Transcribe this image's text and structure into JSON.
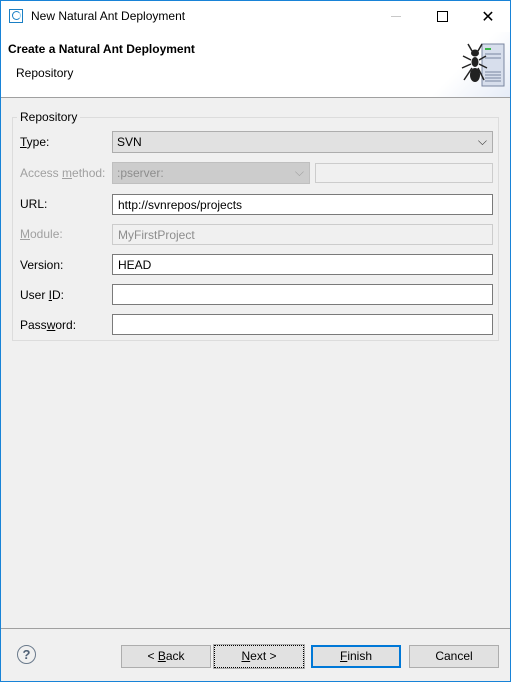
{
  "window": {
    "title": "New Natural Ant Deployment",
    "controls": [
      "minimize",
      "maximize",
      "close"
    ]
  },
  "header": {
    "title": "Create a Natural Ant Deployment",
    "subtitle": "Repository",
    "graphic": "ant-server-icon"
  },
  "repository": {
    "group_label": "Repository",
    "type": {
      "label_pre": "",
      "mnemonic": "T",
      "label_post": "ype:",
      "value": "SVN"
    },
    "access_method": {
      "label_pre": "Access ",
      "mnemonic": "m",
      "label_post": "ethod:",
      "value": ":pserver:",
      "extra_value": "",
      "enabled": false
    },
    "url": {
      "label": "URL:",
      "value": "http://svnrepos/projects"
    },
    "module": {
      "label_pre": "",
      "mnemonic": "M",
      "label_post": "odule:",
      "value": "MyFirstProject",
      "enabled": false
    },
    "version": {
      "label": "Version:",
      "value": "HEAD"
    },
    "user_id": {
      "label_pre": "User ",
      "mnemonic": "I",
      "label_post": "D:",
      "value": ""
    },
    "password": {
      "label_pre": "Pass",
      "mnemonic": "w",
      "label_post": "ord:",
      "value": ""
    }
  },
  "footer": {
    "help_icon": "question-mark",
    "back": {
      "pre": "< ",
      "mnemonic": "B",
      "post": "ack"
    },
    "next": {
      "pre": "",
      "mnemonic": "N",
      "post": "ext >"
    },
    "finish": {
      "pre": "",
      "mnemonic": "F",
      "post": "inish"
    },
    "cancel": "Cancel"
  }
}
